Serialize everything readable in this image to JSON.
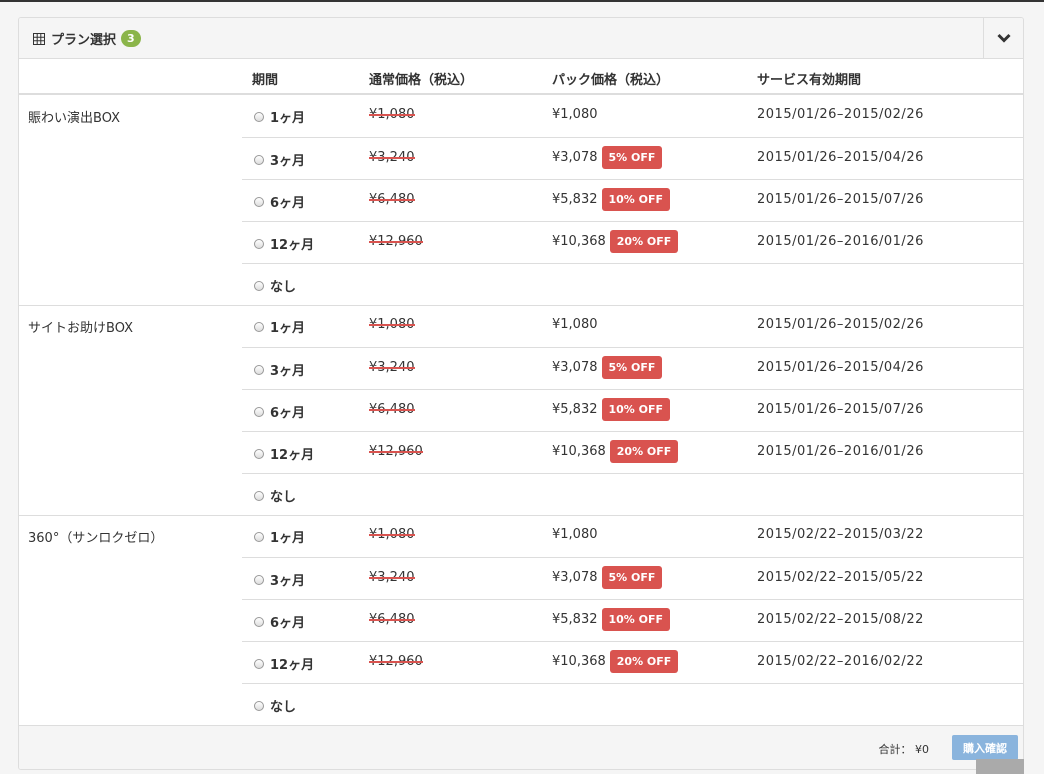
{
  "panel": {
    "title": "プラン選択",
    "badge": "3"
  },
  "columns": {
    "period": "期間",
    "regular": "通常価格（税込）",
    "pack": "パック価格（税込）",
    "validity": "サービス有効期間"
  },
  "groups": [
    {
      "name": "賑わい演出BOX",
      "rows": [
        {
          "period": "1ヶ月",
          "regular": "¥1,080",
          "pack": "¥1,080",
          "off": "",
          "dates": "2015/01/26–2015/02/26"
        },
        {
          "period": "3ヶ月",
          "regular": "¥3,240",
          "pack": "¥3,078",
          "off": "5% OFF",
          "dates": "2015/01/26–2015/04/26"
        },
        {
          "period": "6ヶ月",
          "regular": "¥6,480",
          "pack": "¥5,832",
          "off": "10% OFF",
          "dates": "2015/01/26–2015/07/26"
        },
        {
          "period": "12ヶ月",
          "regular": "¥12,960",
          "pack": "¥10,368",
          "off": "20% OFF",
          "dates": "2015/01/26–2016/01/26"
        },
        {
          "period": "なし",
          "regular": "",
          "pack": "",
          "off": "",
          "dates": ""
        }
      ]
    },
    {
      "name": "サイトお助けBOX",
      "rows": [
        {
          "period": "1ヶ月",
          "regular": "¥1,080",
          "pack": "¥1,080",
          "off": "",
          "dates": "2015/01/26–2015/02/26"
        },
        {
          "period": "3ヶ月",
          "regular": "¥3,240",
          "pack": "¥3,078",
          "off": "5% OFF",
          "dates": "2015/01/26–2015/04/26"
        },
        {
          "period": "6ヶ月",
          "regular": "¥6,480",
          "pack": "¥5,832",
          "off": "10% OFF",
          "dates": "2015/01/26–2015/07/26"
        },
        {
          "period": "12ヶ月",
          "regular": "¥12,960",
          "pack": "¥10,368",
          "off": "20% OFF",
          "dates": "2015/01/26–2016/01/26"
        },
        {
          "period": "なし",
          "regular": "",
          "pack": "",
          "off": "",
          "dates": ""
        }
      ]
    },
    {
      "name": "360°（サンロクゼロ）",
      "rows": [
        {
          "period": "1ヶ月",
          "regular": "¥1,080",
          "pack": "¥1,080",
          "off": "",
          "dates": "2015/02/22–2015/03/22"
        },
        {
          "period": "3ヶ月",
          "regular": "¥3,240",
          "pack": "¥3,078",
          "off": "5% OFF",
          "dates": "2015/02/22–2015/05/22"
        },
        {
          "period": "6ヶ月",
          "regular": "¥6,480",
          "pack": "¥5,832",
          "off": "10% OFF",
          "dates": "2015/02/22–2015/08/22"
        },
        {
          "period": "12ヶ月",
          "regular": "¥12,960",
          "pack": "¥10,368",
          "off": "20% OFF",
          "dates": "2015/02/22–2016/02/22"
        },
        {
          "period": "なし",
          "regular": "",
          "pack": "",
          "off": "",
          "dates": ""
        }
      ]
    }
  ],
  "footer": {
    "total_label": "合計：",
    "total_value": "¥0",
    "buy_label": "購入確認"
  },
  "icons": {
    "title_icon": "table-grid-icon",
    "toggle_icon": "chevron-down-icon"
  },
  "colors": {
    "badge": "#8bb54a",
    "off_label": "#d9534f",
    "buy_button": "#8ab4dd"
  }
}
